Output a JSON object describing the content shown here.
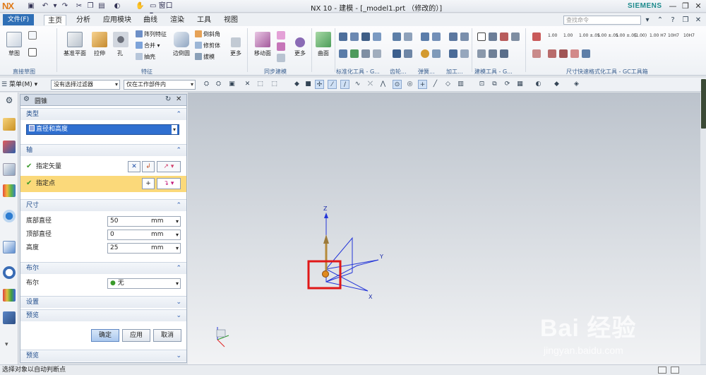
{
  "app": {
    "logo": "NX",
    "title": "NX 10 - 建模 - [_model1.prt （修改的）]",
    "brand": "SIEMENS"
  },
  "quick_access": {
    "window_label": "窗口"
  },
  "tabs": {
    "file": "文件(F)",
    "items": [
      "主页",
      "分析",
      "应用模块",
      "曲线",
      "渲染",
      "工具",
      "视图"
    ],
    "active": "主页"
  },
  "search": {
    "placeholder": "查找命令"
  },
  "ribbon": {
    "sketch": {
      "label": "草图",
      "group": "直接草图"
    },
    "feature": {
      "datum": "基准平面",
      "extrude": "拉伸",
      "hole": "孔",
      "pattern": "阵列特征",
      "unite": "合并",
      "shell": "抽壳",
      "edge_blend": "边倒圆",
      "chamfer": "倒斜角",
      "trim_body": "修剪体",
      "draft": "拔模",
      "more": "更多",
      "group": "特征"
    },
    "sync": {
      "move_face": "移动面",
      "more": "更多",
      "group": "同步建模"
    },
    "surface": {
      "label": "曲面"
    },
    "groups": {
      "std": "标准化工具 - G...",
      "gear": "齿轮...",
      "spring": "弹簧...",
      "machining": "加工...",
      "modeling_tools": "建模工具 - G...",
      "dimension": "尺寸快速格式化工具 - GC工具箱"
    },
    "dim_values": [
      "1.00",
      "1.00",
      "1.00 ±.05",
      "1.00 ±.05",
      "1.00 ±.05",
      "(1.00)",
      "1.00 H7",
      "10H7",
      "10H7"
    ]
  },
  "toolbar2": {
    "menu": "菜单(M)",
    "filter": "没有选择过滤器",
    "scope": "仅在工作部件内"
  },
  "dialog": {
    "title": "圆锥",
    "type_section": "类型",
    "type_value": "直径和高度",
    "axis_section": "轴",
    "specify_vector": "指定矢量",
    "specify_point": "指定点",
    "dimensions_section": "尺寸",
    "bottom_diameter": {
      "label": "底部直径",
      "value": "50",
      "unit": "mm"
    },
    "top_diameter": {
      "label": "顶部直径",
      "value": "0",
      "unit": "mm"
    },
    "height": {
      "label": "高度",
      "value": "25",
      "unit": "mm"
    },
    "boolean_section": "布尔",
    "boolean_label": "布尔",
    "boolean_value": "无",
    "settings_section": "设置",
    "preview_section": "预览",
    "ok": "确定",
    "apply": "应用",
    "cancel": "取消",
    "preview_footer": "预览"
  },
  "viewport": {
    "axes": {
      "z": "Z",
      "y": "Y",
      "x": "X"
    },
    "highlight_color": "#e01818"
  },
  "watermark": {
    "brand": "Bai 经验",
    "url": "jingyan.baidu.com"
  },
  "status": {
    "message": "选择对象以自动判断点"
  }
}
